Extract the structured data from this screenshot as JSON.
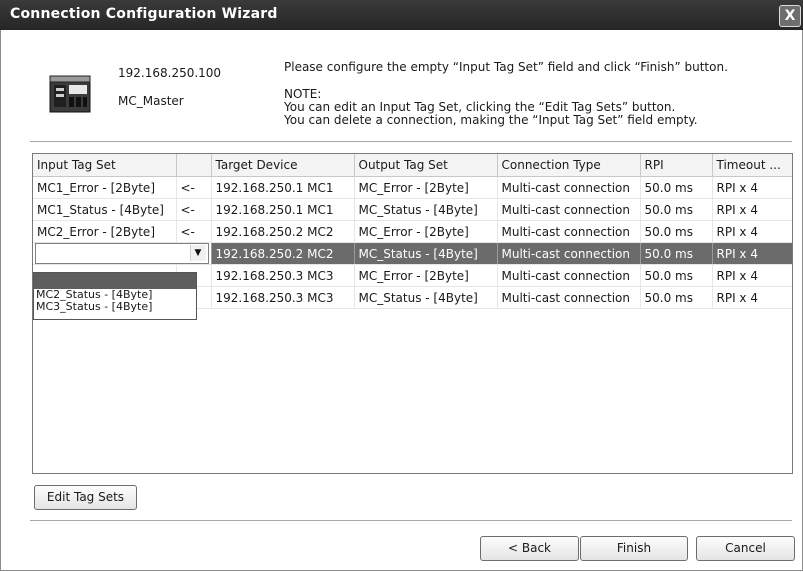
{
  "window": {
    "title": "Connection Configuration Wizard",
    "close_glyph": "X"
  },
  "device": {
    "ip": "192.168.250.100",
    "name": "MC_Master",
    "icon": "plc-controller-icon"
  },
  "instructions": "Please configure the empty “Input Tag Set” field and click “Finish” button.",
  "note": {
    "heading": "NOTE:",
    "line1": "You can edit an Input Tag Set, clicking the “Edit Tag Sets” button.",
    "line2": "You can delete a connection, making the “Input Tag Set” field empty."
  },
  "table": {
    "columns": [
      "Input Tag Set",
      "",
      "Target Device",
      "Output Tag Set",
      "Connection Type",
      "RPI",
      "Timeout ..."
    ],
    "rows": [
      [
        "MC1_Error - [2Byte]",
        "<-",
        "192.168.250.1 MC1",
        "MC_Error - [2Byte]",
        "Multi-cast connection",
        "50.0 ms",
        "RPI x 4"
      ],
      [
        "MC1_Status - [4Byte]",
        "<-",
        "192.168.250.1 MC1",
        "MC_Status - [4Byte]",
        "Multi-cast connection",
        "50.0 ms",
        "RPI x 4"
      ],
      [
        "MC2_Error - [2Byte]",
        "<-",
        "192.168.250.2 MC2",
        "MC_Error - [2Byte]",
        "Multi-cast connection",
        "50.0 ms",
        "RPI x 4"
      ],
      [
        "",
        "",
        "192.168.250.2 MC2",
        "MC_Status - [4Byte]",
        "Multi-cast connection",
        "50.0 ms",
        "RPI x 4"
      ],
      [
        "",
        "",
        "192.168.250.3 MC3",
        "MC_Error - [2Byte]",
        "Multi-cast connection",
        "50.0 ms",
        "RPI x 4"
      ],
      [
        "",
        "",
        "192.168.250.3 MC3",
        "MC_Status - [4Byte]",
        "Multi-cast connection",
        "50.0 ms",
        "RPI x 4"
      ]
    ],
    "selected_row_index": 3
  },
  "dropdown": {
    "options": [
      "MC2_Status - [4Byte]",
      "MC3_Status - [4Byte]"
    ]
  },
  "buttons": {
    "edit_tag_sets": "Edit Tag Sets",
    "back": "< Back",
    "finish": "Finish",
    "cancel": "Cancel"
  },
  "colors": {
    "titlebar": "#2e2e2e",
    "selection": "#6b6b6b",
    "dropdown_highlight": "#5e5e5e"
  }
}
